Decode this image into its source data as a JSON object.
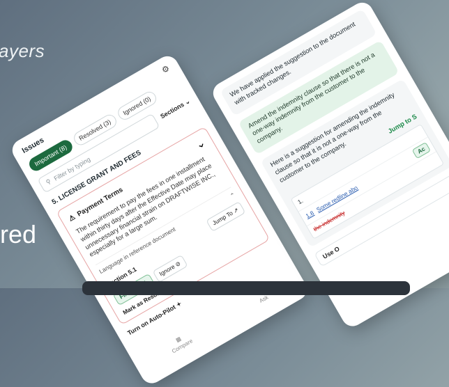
{
  "background": {
    "top_text": "ayers",
    "bottom_text": "red"
  },
  "issues_panel": {
    "title": "Issues",
    "tabs": [
      {
        "label": "Important (8)"
      },
      {
        "label": "Resolved (3)"
      },
      {
        "label": "Ignored (0)"
      }
    ],
    "filter_placeholder": "Filter by typing",
    "sections_label": "Sections",
    "section_heading": "5. LICENSE GRANT AND FEES",
    "issue": {
      "title": "Payment Terms",
      "body": "The requirement to pay the fees in one installment within thirty days after the Effective Date may place unnecessary financial strain on DRAFTWISE INC., especially for a large sum.",
      "language_label": "Language in reference document",
      "reference_label": "Section 5.1",
      "jump_to_label": "Jump To",
      "fix_issue_label": "Fix Issue",
      "ignore_label": "Ignore",
      "mark_resolved_label": "Mark as Resolved"
    },
    "autopilot_label": "Turn on Auto-Pilot",
    "nav": [
      {
        "label": "Compare"
      },
      {
        "label": "Ask"
      }
    ]
  },
  "chat_panel": {
    "messages": [
      {
        "text": "We have applied the suggestion to the document with tracked changes."
      },
      {
        "text": "Amend the indemnity clause so that there is not a one-way indemnity from the customer to the company."
      },
      {
        "text": "Here is a suggestion for amending the indemnity clause so that it is not a one-way from the customer to the company."
      }
    ],
    "jump_link": "Jump to S",
    "redline": {
      "row1_num": "1.",
      "row2_num": "1.8",
      "row2_link": "Some redline abo",
      "row2_deleted": "the indemnity",
      "accept_label": "Ac"
    },
    "use_label": "Use O"
  },
  "colors": {
    "accent_green": "#1d6a3f",
    "issue_border": "#e6a3a3",
    "chat_green_bg": "#e3f3e8"
  }
}
